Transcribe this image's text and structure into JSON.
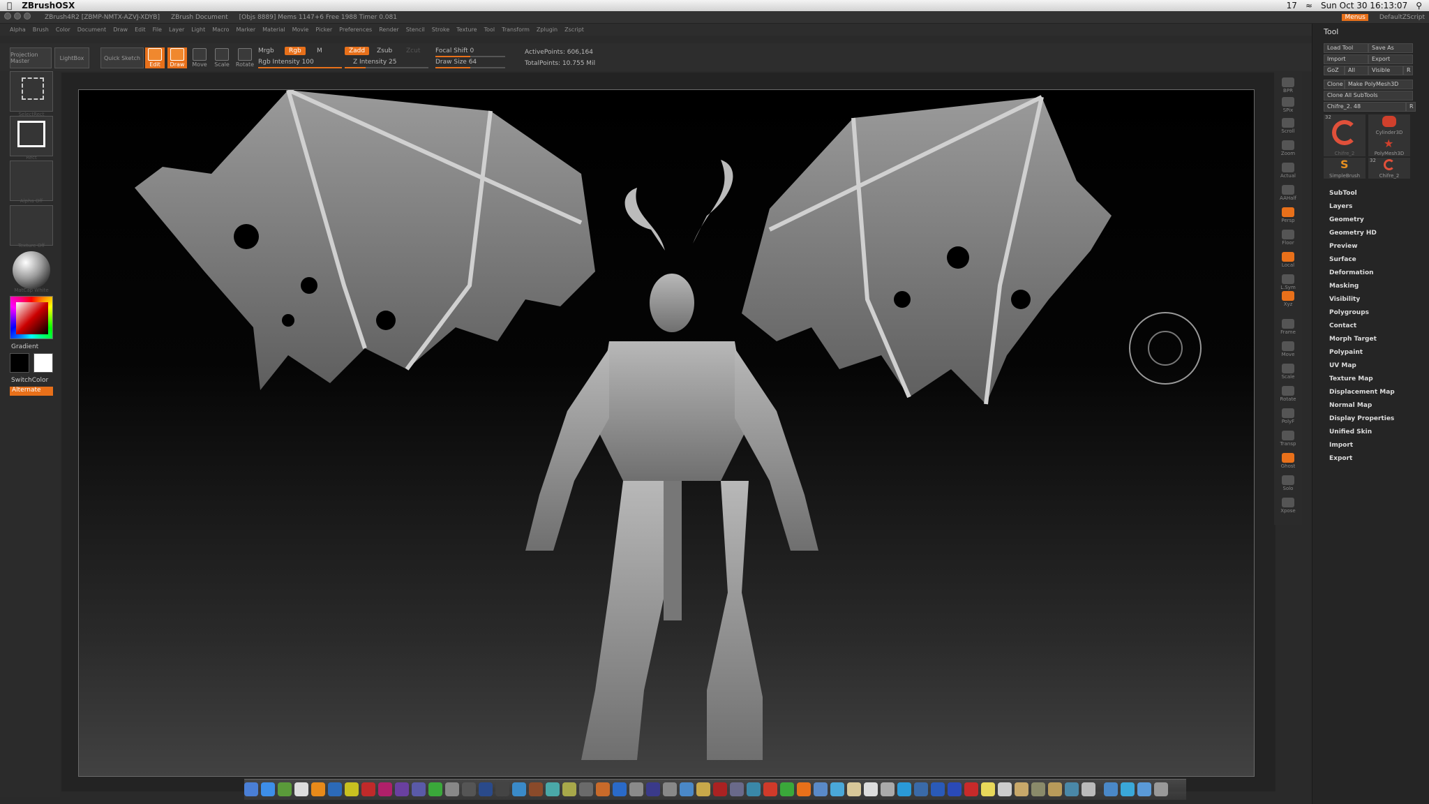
{
  "mac_menubar": {
    "app": "ZBrushOSX",
    "status_items": [
      "17",
      "Sun Oct 30 16:13:07"
    ]
  },
  "titlebar": {
    "app_version": "ZBrush4R2 [ZBMP-NMTX-AZVJ-XDYB]",
    "doc_name": "ZBrush Document",
    "stats": "[Objs 8889] Mems 1147+6 Free 1988 Timer 0.081",
    "buttons": [
      "Menus",
      "DefaultZScript"
    ]
  },
  "menubar": {
    "items": [
      "Alpha",
      "Brush",
      "Color",
      "Document",
      "Draw",
      "Edit",
      "File",
      "Layer",
      "Light",
      "Macro",
      "Marker",
      "Material",
      "Movie",
      "Picker",
      "Preferences",
      "Render",
      "Stencil",
      "Stroke",
      "Texture",
      "Tool",
      "Transform",
      "Zplugin",
      "Zscript"
    ]
  },
  "toolbar": {
    "projection_master": "Projection Master",
    "lightbox": "LightBox",
    "quick_sketch": "Quick Sketch",
    "edit": "Edit",
    "draw": "Draw",
    "move": "Move",
    "scale": "Scale",
    "rotate": "Rotate",
    "mrgb": "Mrgb",
    "rgb": "Rgb",
    "m": "M",
    "rgb_intensity_label": "Rgb Intensity 100",
    "rgb_intensity": 100,
    "zadd": "Zadd",
    "zsub": "Zsub",
    "zcut": "Zcut",
    "z_intensity_label": "Z Intensity 25",
    "z_intensity": 25,
    "focal_shift_label": "Focal Shift 0",
    "draw_size_label": "Draw Size 64",
    "active_points": "ActivePoints: 606,164",
    "total_points": "TotalPoints: 10.755 Mil"
  },
  "leftpanel": {
    "select_rect": "SelectRect",
    "rect": "Rect",
    "alpha_off": "Alpha Off",
    "texture_off": "Texture Off",
    "matcap": "MatCap White",
    "gradient": "Gradient",
    "switch_color": "SwitchColor",
    "alternate": "Alternate"
  },
  "rightstrip": {
    "items": [
      "BPR",
      "SPix",
      "Scroll",
      "Zoom",
      "Actual",
      "AAHalf",
      "Persp",
      "Floor",
      "Local",
      "L.Sym",
      "Xyz",
      "Frame",
      "Move",
      "Scale",
      "Rotate",
      "PolyF",
      "Transp",
      "Ghost",
      "Solo",
      "Xpose"
    ]
  },
  "toolpanel": {
    "title": "Tool",
    "buttons": {
      "load_tool": "Load Tool",
      "save_as": "Save As",
      "import": "Import",
      "export": "Export",
      "goz": "GoZ",
      "all": "All",
      "visible": "Visible",
      "r": "R",
      "clone": "Clone",
      "make_polymesh": "Make PolyMesh3D",
      "clone_all": "Clone All SubTools"
    },
    "current_tool": "Chifre_2. 48",
    "brushes": [
      "Chifre_2",
      "Cylinder3D",
      "PolyMesh3D",
      "SimpleBrush",
      "Chifre_2"
    ],
    "thumb_counts": [
      "32",
      "32"
    ],
    "sections": [
      "SubTool",
      "Layers",
      "Geometry",
      "Geometry HD",
      "Preview",
      "Surface",
      "Deformation",
      "Masking",
      "Visibility",
      "Polygroups",
      "Contact",
      "Morph Target",
      "Polypaint",
      "UV Map",
      "Texture Map",
      "Displacement Map",
      "Normal Map",
      "Display Properties",
      "Unified Skin",
      "Import",
      "Export"
    ]
  },
  "colors": {
    "accent": "#e8701a",
    "panel": "#2b2b2b",
    "canvas_top": "#000000",
    "canvas_bottom": "#424242"
  }
}
